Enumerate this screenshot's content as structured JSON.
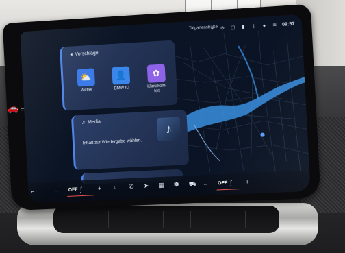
{
  "status": {
    "street": "Talgartenstraße",
    "clock": "09:57",
    "icons": [
      "location-icon",
      "mic-off-icon",
      "media-icon",
      "signal-icon",
      "bluetooth-icon",
      "user-icon",
      "wifi-icon"
    ]
  },
  "suggestions": {
    "title": "Vorschläge",
    "tiles": [
      {
        "label": "Wetter",
        "icon": "weather-icon",
        "glyph": "⛅"
      },
      {
        "label": "BMW ID",
        "icon": "profile-icon",
        "glyph": "👤"
      },
      {
        "label": "Klimakom-\nfort",
        "icon": "climate-icon",
        "glyph": "✿"
      }
    ]
  },
  "media": {
    "title": "Media",
    "message": "Inhalt zur Wiedergabe wählen."
  },
  "bottom_bar": {
    "left_temp_minus": "–",
    "left_temp_value": "OFF",
    "left_temp_plus": "+",
    "right_temp_minus": "–",
    "right_temp_value": "OFF",
    "right_temp_plus": "+"
  },
  "colors": {
    "accent": "#4f83e6",
    "panel": "#24355a",
    "map_bg": "#0a1220",
    "river": "#3a8ee0"
  }
}
